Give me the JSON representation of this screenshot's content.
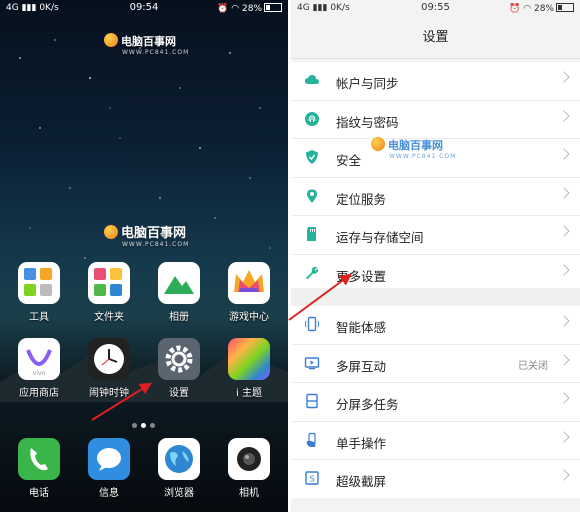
{
  "left_screen": {
    "status_bar": {
      "network": "4G",
      "speed": "0K/s",
      "time": "09:54",
      "battery": "28%"
    },
    "watermark": {
      "title": "电脑百事网",
      "url": "WWW.PC841.COM"
    },
    "center_watermark": {
      "title": "电脑百事网",
      "url": "WWW.PC841.COM"
    },
    "apps_row1": [
      {
        "label": "工具"
      },
      {
        "label": "文件夹"
      },
      {
        "label": "相册"
      },
      {
        "label": "游戏中心"
      }
    ],
    "apps_row2": [
      {
        "label": "应用商店"
      },
      {
        "label": "闹钟时钟"
      },
      {
        "label": "设置"
      },
      {
        "label": "i 主题"
      }
    ],
    "dock": [
      {
        "label": "电话"
      },
      {
        "label": "信息"
      },
      {
        "label": "浏览器"
      },
      {
        "label": "相机"
      }
    ]
  },
  "right_screen": {
    "status_bar": {
      "network": "4G",
      "speed": "0K/s",
      "time": "09:55",
      "battery": "28%"
    },
    "title": "设置",
    "watermark": {
      "title": "电脑百事网",
      "url": "WWW.PC841.COM"
    },
    "group1": [
      {
        "label": "帐户与同步",
        "icon": "cloud-icon"
      },
      {
        "label": "指纹与密码",
        "icon": "fingerprint-icon"
      },
      {
        "label": "安全",
        "icon": "shield-icon"
      },
      {
        "label": "定位服务",
        "icon": "location-pin-icon"
      },
      {
        "label": "运存与存储空间",
        "icon": "sd-card-icon"
      },
      {
        "label": "更多设置",
        "icon": "wrench-icon"
      }
    ],
    "group2": [
      {
        "label": "智能体感",
        "icon": "phone-gesture-icon",
        "value": ""
      },
      {
        "label": "多屏互动",
        "icon": "multi-screen-icon",
        "value": "已关闭"
      },
      {
        "label": "分屏多任务",
        "icon": "split-screen-icon",
        "value": ""
      },
      {
        "label": "单手操作",
        "icon": "one-hand-icon",
        "value": ""
      },
      {
        "label": "超级截屏",
        "icon": "screenshot-icon",
        "value": ""
      }
    ]
  },
  "colors": {
    "accent": "#25b39a",
    "icon_blue": "#3b7fd0",
    "arrow_red": "#e02020"
  }
}
